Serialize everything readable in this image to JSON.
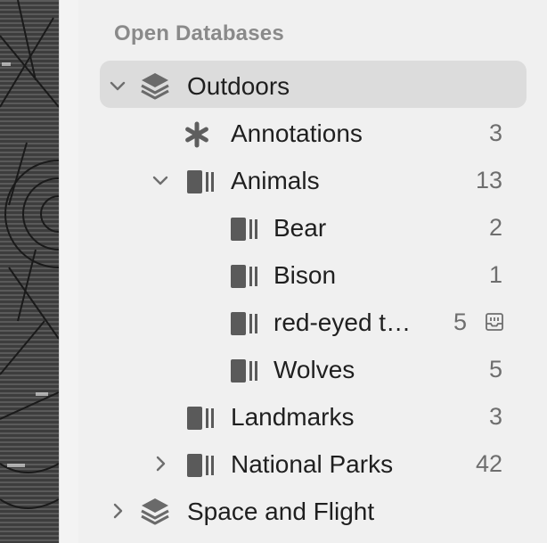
{
  "sidebar": {
    "section_title": "Open Databases",
    "databases": [
      {
        "label": "Outdoors",
        "icon": "stack-icon",
        "expanded": true,
        "selected": true
      },
      {
        "label": "Space and Flight",
        "icon": "stack-icon",
        "expanded": false,
        "selected": false
      }
    ],
    "items": [
      {
        "label": "Annotations",
        "icon": "asterisk-icon",
        "count": "3"
      },
      {
        "label": "Animals",
        "icon": "group-icon",
        "count": "13",
        "expanded": true
      },
      {
        "label": "Bear",
        "icon": "group-icon",
        "count": "2"
      },
      {
        "label": "Bison",
        "icon": "group-icon",
        "count": "1"
      },
      {
        "label": "red-eyed t…",
        "icon": "group-icon",
        "count": "5",
        "badge": "inbox-icon"
      },
      {
        "label": "Wolves",
        "icon": "group-icon",
        "count": "5"
      },
      {
        "label": "Landmarks",
        "icon": "group-icon",
        "count": "3"
      },
      {
        "label": "National Parks",
        "icon": "group-icon",
        "count": "42",
        "expanded": false
      }
    ]
  },
  "colors": {
    "sidebar_bg": "#f0f0f0",
    "selection_bg": "#dcdcdc",
    "text": "#1f1f1f",
    "count_text": "#6e6e6e",
    "section_title": "#8a8a8a"
  }
}
